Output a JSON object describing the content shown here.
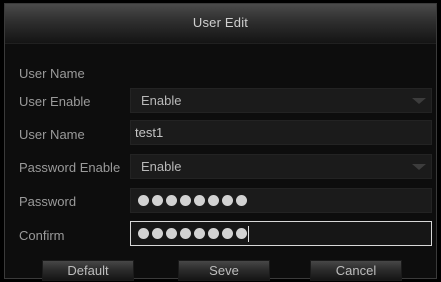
{
  "dialog": {
    "title": "User Edit",
    "section_label": "User Name",
    "rows": {
      "user_enable": {
        "label": "User Enable",
        "value": "Enable"
      },
      "user_name": {
        "label": "User Name",
        "value": "test1"
      },
      "password_enable": {
        "label": "Password Enable",
        "value": "Enable"
      },
      "password": {
        "label": "Password",
        "masked_length": 8
      },
      "confirm": {
        "label": "Confirm",
        "masked_length": 8
      }
    },
    "buttons": {
      "default": "Default",
      "save": "Seve",
      "cancel": "Cancel"
    }
  },
  "icons": {
    "dropdown": "chevron-down-icon",
    "mask": "password-dot-icon"
  },
  "colors": {
    "background": "#0d0d0d",
    "field": "#1b1b1b",
    "text": "#9a9a9a",
    "focus_border": "#d8d8d8"
  }
}
